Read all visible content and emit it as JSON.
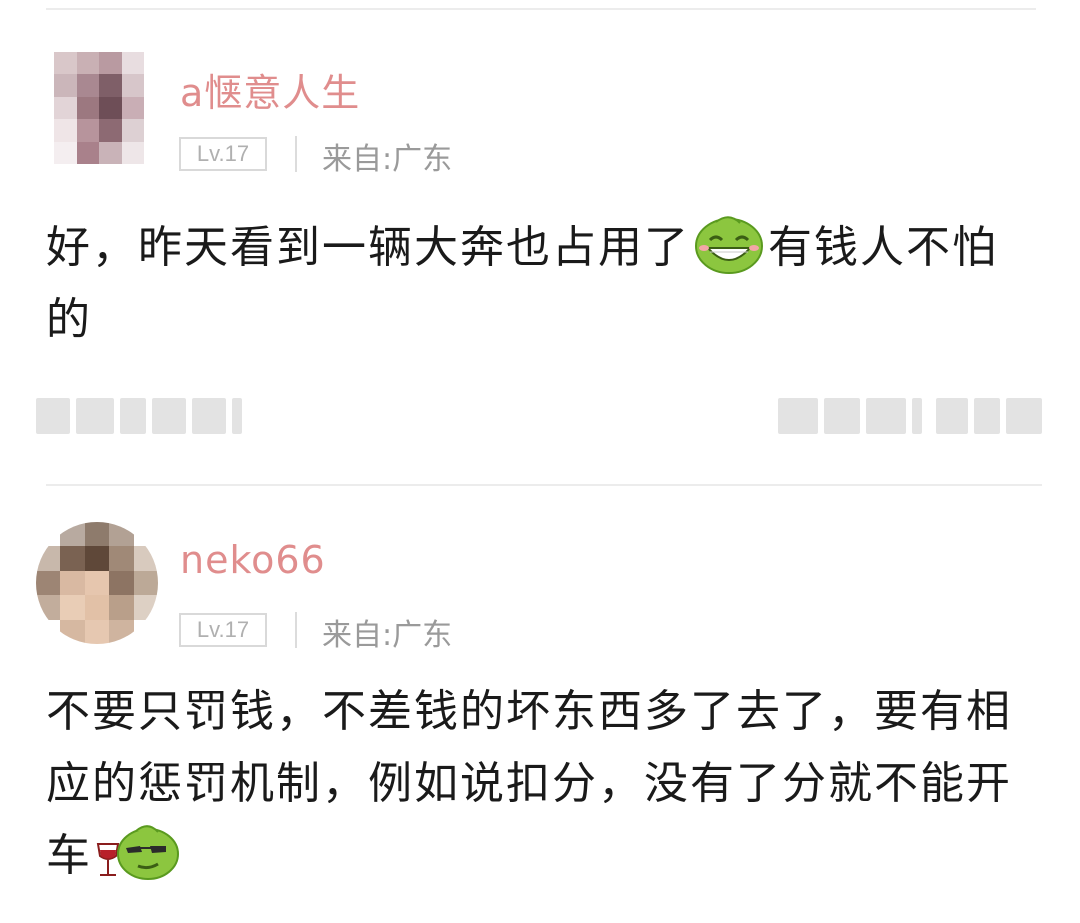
{
  "comments": [
    {
      "username": "a惬意人生",
      "level": "Lv.17",
      "location": "来自:广东",
      "text_before": "好，昨天看到一辆大奔也占用了",
      "emoji_1": "grin-emoji",
      "text_after": "有钱人不怕的",
      "emoji_2": ""
    },
    {
      "username": "neko66",
      "level": "Lv.17",
      "location": "来自:广东",
      "text_before": "不要只罚钱，不差钱的坏东西多了去了，要有相应的惩罚机制，例如说扣分，没有了分就不能开车",
      "emoji_1": "wine-cool-emoji",
      "text_after": ""
    }
  ],
  "colors": {
    "username": "#e08d8d",
    "emoji_green": "#8cc63f"
  }
}
